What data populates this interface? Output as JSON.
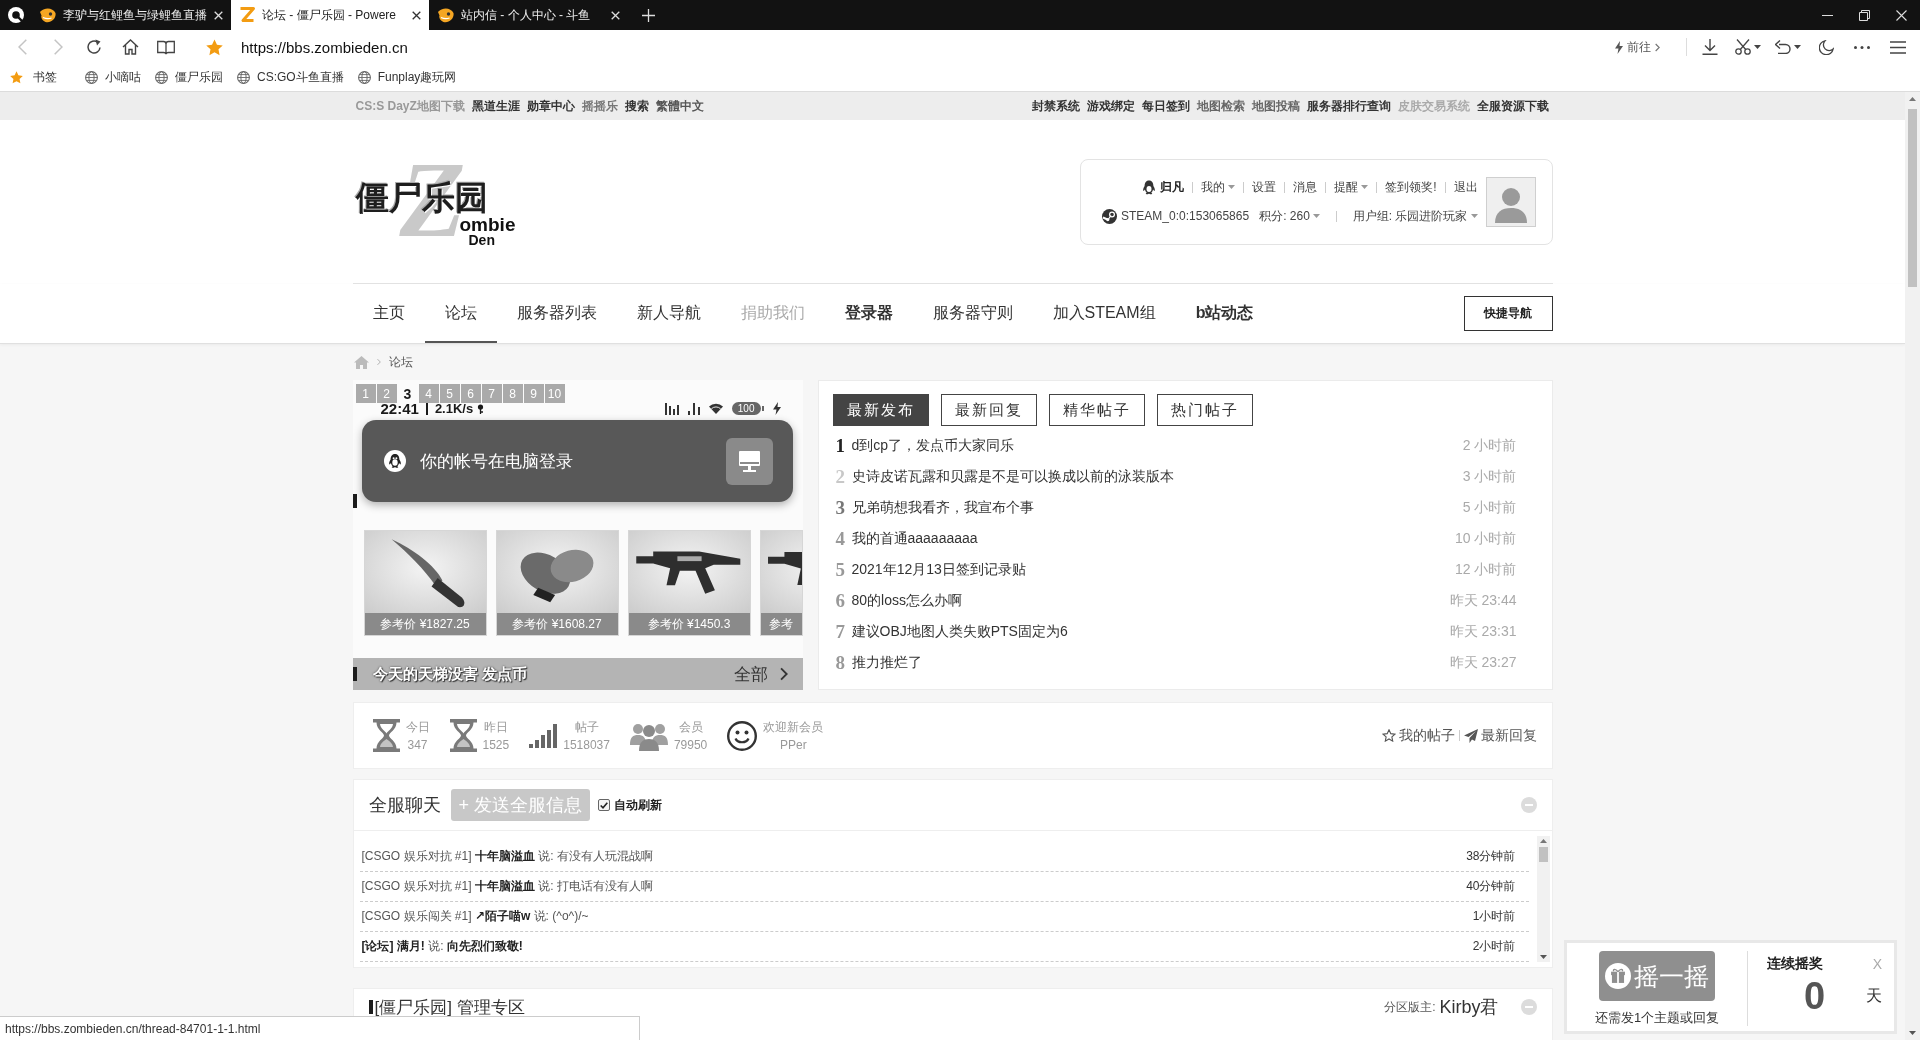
{
  "browser": {
    "tabs": [
      {
        "title": "李驴与红鲤鱼与绿鲤鱼直播",
        "selected": false,
        "kind": "fish"
      },
      {
        "title": "论坛 - 僵尸乐园 - Powere",
        "selected": true,
        "kind": "z"
      },
      {
        "title": "站内信 - 个人中心 - 斗鱼",
        "selected": false,
        "kind": "fish"
      }
    ],
    "url": "https://bbs.zombieden.cn",
    "go_button": "前往",
    "bookmarks": [
      {
        "label": "书签",
        "kind": "star"
      },
      {
        "label": "小嘀咕",
        "kind": "globe"
      },
      {
        "label": "僵尸乐园",
        "kind": "globe"
      },
      {
        "label": "CS:GO斗鱼直播",
        "kind": "globe"
      },
      {
        "label": "Funplay趣玩网",
        "kind": "globe"
      }
    ]
  },
  "top_links": {
    "left": [
      {
        "label": "CS:S DayZ地图下载",
        "color": "#999999"
      },
      {
        "label": "黑道生涯",
        "color": "#333333"
      },
      {
        "label": "勋章中心",
        "color": "#333333"
      },
      {
        "label": "摇摇乐",
        "color": "#777777"
      },
      {
        "label": "搜索",
        "color": "#333333"
      },
      {
        "label": "繁體中文",
        "color": "#555555"
      }
    ],
    "right": [
      {
        "label": "封禁系统",
        "color": "#333333"
      },
      {
        "label": "游戏绑定",
        "color": "#333333"
      },
      {
        "label": "每日签到",
        "color": "#333333"
      },
      {
        "label": "地图检索",
        "color": "#666666"
      },
      {
        "label": "地图投稿",
        "color": "#666666"
      },
      {
        "label": "服务器排行查询",
        "color": "#333333"
      },
      {
        "label": "皮肤交易系统",
        "color": "#aaaaaa"
      },
      {
        "label": "全服资源下载",
        "color": "#333333"
      }
    ]
  },
  "header": {
    "logo": {
      "title": "僵尸乐园",
      "letter": "Z",
      "word": "ombie",
      "word_2": "Den"
    },
    "user_panel": {
      "username": "归凡",
      "menu": [
        {
          "label": "我的",
          "dropdown": true
        },
        {
          "label": "设置",
          "dropdown": false
        },
        {
          "label": "消息",
          "dropdown": false
        },
        {
          "label": "提醒",
          "dropdown": true
        },
        {
          "label": "签到领奖!",
          "dropdown": false
        },
        {
          "label": "退出",
          "dropdown": false
        }
      ],
      "steam_id": "STEAM_0:0:153065865",
      "points": {
        "label": "积分: 260",
        "dropdown": true
      },
      "user_group": {
        "label": "用户组: 乐园进阶玩家",
        "dropdown": true
      }
    }
  },
  "nav": {
    "items": [
      {
        "label": "主页",
        "selected": false,
        "kind": "normal"
      },
      {
        "label": "论坛",
        "selected": true,
        "kind": "normal"
      },
      {
        "label": "服务器列表",
        "selected": false,
        "kind": "normal"
      },
      {
        "label": "新人导航",
        "selected": false,
        "kind": "normal"
      },
      {
        "label": "捐助我们",
        "selected": false,
        "kind": "muted"
      },
      {
        "label": "登录器",
        "selected": false,
        "kind": "bold"
      },
      {
        "label": "服务器守则",
        "selected": false,
        "kind": "normal"
      },
      {
        "label": "加入STEAM组",
        "selected": false,
        "kind": "normal"
      },
      {
        "label": "b站动态",
        "selected": false,
        "kind": "bold"
      }
    ],
    "quick_nav": "快捷导航"
  },
  "breadcrumb": [
    "论坛"
  ],
  "slideshow": {
    "pages": [
      {
        "label": "1",
        "selected": false
      },
      {
        "label": "2",
        "selected": false
      },
      {
        "label": "3",
        "selected": true
      },
      {
        "label": "4",
        "selected": false
      },
      {
        "label": "5",
        "selected": false
      },
      {
        "label": "6",
        "selected": false
      },
      {
        "label": "7",
        "selected": false
      },
      {
        "label": "8",
        "selected": false
      },
      {
        "label": "9",
        "selected": false
      },
      {
        "label": "10",
        "selected": false
      }
    ],
    "phone_status": {
      "time": "22:41",
      "speed": "2.1K/s",
      "battery": "100"
    },
    "toast": "你的帐号在电脑登录",
    "items": [
      {
        "price": "参考价 ¥1827.25",
        "kind": "knife"
      },
      {
        "price": "参考价 ¥1608.27",
        "kind": "gloves"
      },
      {
        "price": "参考价 ¥1450.3",
        "kind": "rifle"
      },
      {
        "price": "参考",
        "kind": "rifle"
      }
    ],
    "caption": "今天的天梯没害 发点币",
    "more": "全部"
  },
  "posts": {
    "tabs": [
      {
        "label": "最新发布",
        "selected": true
      },
      {
        "label": "最新回复",
        "selected": false
      },
      {
        "label": "精华帖子",
        "selected": false
      },
      {
        "label": "热门帖子",
        "selected": false
      }
    ],
    "rows": [
      {
        "rank": "1",
        "color": "#222222",
        "title": "d到cp了，发点币大家同乐",
        "time": "2 小时前"
      },
      {
        "rank": "2",
        "color": "#c8c8c8",
        "title": "史诗皮诺瓦露和贝露是不是可以换成以前的泳装版本",
        "time": "3 小时前"
      },
      {
        "rank": "3",
        "color": "#777777",
        "title": "兄弟萌想我看齐，我宣布个事",
        "time": "5 小时前"
      },
      {
        "rank": "4",
        "color": "#999999",
        "title": "我的首通aaaaaaaaa",
        "time": "10 小时前"
      },
      {
        "rank": "5",
        "color": "#999999",
        "title": "2021年12月13日签到记录贴",
        "time": "12 小时前"
      },
      {
        "rank": "6",
        "color": "#999999",
        "title": "80的loss怎么办啊",
        "time": "昨天 23:44"
      },
      {
        "rank": "7",
        "color": "#999999",
        "title": "建议OBJ地图人类失败PTS固定为6",
        "time": "昨天 23:31"
      },
      {
        "rank": "8",
        "color": "#999999",
        "title": "推力推烂了",
        "time": "昨天 23:27"
      }
    ]
  },
  "stats": {
    "items": [
      {
        "kind": "hourglass",
        "label": "今日",
        "value": "347"
      },
      {
        "kind": "hourglass",
        "label": "昨日",
        "value": "1525"
      },
      {
        "kind": "bars",
        "label": "帖子",
        "value": "1518037"
      },
      {
        "kind": "users",
        "label": "会员",
        "value": "79950"
      },
      {
        "kind": "smile",
        "label": "欢迎新会员",
        "value": "PPer"
      }
    ],
    "links": [
      {
        "kind": "star",
        "label": "我的帖子"
      },
      {
        "kind": "plane",
        "label": "最新回复"
      }
    ]
  },
  "chat": {
    "title": "全服聊天",
    "send_button": "+ 发送全服信息",
    "auto_refresh": {
      "label": "自动刷新",
      "checked": true
    },
    "messages": [
      {
        "text": "[CSGO 娱乐对抗 #1] **十年脑溢血** 说: 有没有人玩混战啊",
        "time": "38分钟前"
      },
      {
        "text": "[CSGO 娱乐对抗 #1] **十年脑溢血** 说: 打电话有没有人啊",
        "time": "40分钟前"
      },
      {
        "text": "[CSGO 娱乐闯关 #1] **↗陌子喵w** 说: (^o^)/~",
        "time": "1小时前"
      },
      {
        "text": "**[论坛] 满月!** 说: **向先烈们致敬!**",
        "time": "2小时前"
      }
    ]
  },
  "section": {
    "title": "[僵尸乐园] 管理专区",
    "moderator_label": "分区版主:",
    "moderator": "Kirby君"
  },
  "lottery": {
    "button": "摇一摇",
    "hint": "还需发1个主题或回复",
    "title": "连续摇奖",
    "close": "X",
    "days": "0",
    "unit": "天"
  },
  "status_url": "https://bbs.zombieden.cn/thread-84701-1-1.html"
}
